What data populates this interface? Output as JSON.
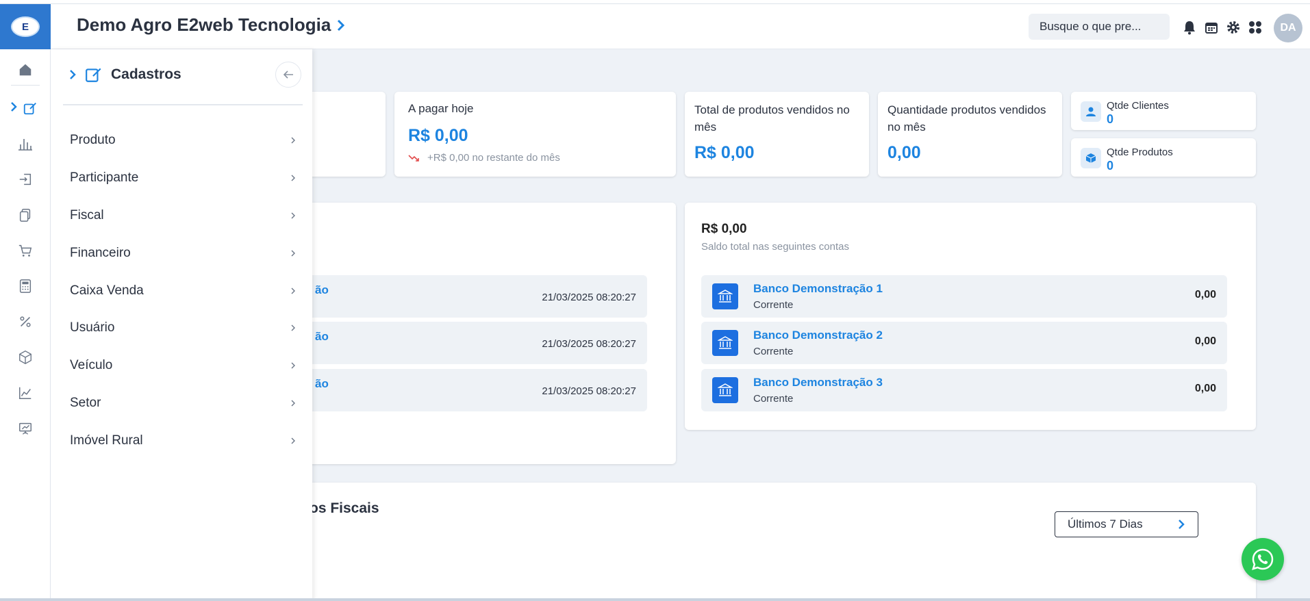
{
  "header": {
    "company": "Demo Agro E2web Tecnologia",
    "search_placeholder": "Busque o que pre...",
    "avatar_initials": "DA",
    "logo_text": "E"
  },
  "panel": {
    "title": "Cadastros",
    "items": [
      {
        "label": "Produto"
      },
      {
        "label": "Participante"
      },
      {
        "label": "Fiscal"
      },
      {
        "label": "Financeiro"
      },
      {
        "label": "Caixa Venda"
      },
      {
        "label": "Usuário"
      },
      {
        "label": "Veículo"
      },
      {
        "label": "Setor"
      },
      {
        "label": "Imóvel Rural"
      }
    ]
  },
  "cards": {
    "pagar_hoje": {
      "label": "A pagar hoje",
      "value": "R$ 0,00",
      "sub": "+R$ 0,00 no restante do mês"
    },
    "total_vendidos": {
      "label": "Total de produtos vendidos no mês",
      "value": "R$ 0,00"
    },
    "qtd_vendidos": {
      "label": "Quantidade produtos vendidos no mês",
      "value": "0,00"
    },
    "qtde_clientes": {
      "label": "Qtde Clientes",
      "value": "0"
    },
    "qtde_produtos": {
      "label": "Qtde Produtos",
      "value": "0"
    }
  },
  "activity": {
    "rows": [
      {
        "title": "ão",
        "date": "21/03/2025 08:20:27"
      },
      {
        "title": "ão",
        "date": "21/03/2025 08:20:27"
      },
      {
        "title": "ão",
        "date": "21/03/2025 08:20:27"
      }
    ]
  },
  "balance": {
    "total": "R$ 0,00",
    "caption": "Saldo total nas seguintes contas",
    "accounts": [
      {
        "name": "Banco Demonstração 1",
        "type": "Corrente",
        "amount": "0,00"
      },
      {
        "name": "Banco Demonstração 2",
        "type": "Corrente",
        "amount": "0,00"
      },
      {
        "name": "Banco Demonstração 3",
        "type": "Corrente",
        "amount": "0,00"
      }
    ]
  },
  "fiscal": {
    "title_partial": "os Fiscais",
    "period": "Últimos 7 Dias"
  },
  "colors": {
    "accent": "#1d84e0",
    "brand": "#2e78cf",
    "whatsapp": "#2bc856"
  }
}
